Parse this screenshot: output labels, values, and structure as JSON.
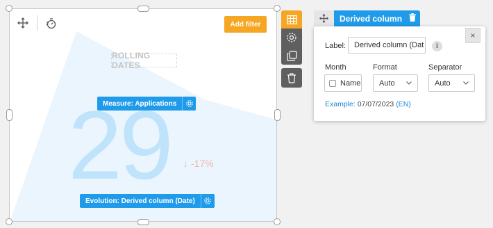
{
  "widget": {
    "add_filter_label": "Add filter",
    "placeholder_title": "ROLLING DATES",
    "kpi_value": "29",
    "evolution_arrow": "↓",
    "evolution_value": "-17%",
    "measure_pill": "Measure: Applications",
    "evolution_pill": "Evolution: Derived column (Date)",
    "toolbar": {
      "move_icon": "move-icon",
      "history_icon": "history-timer-icon"
    }
  },
  "side_tools": [
    {
      "icon": "table-icon",
      "active": true
    },
    {
      "icon": "gear-icon",
      "active": false
    },
    {
      "icon": "duplicate-icon",
      "active": false
    },
    {
      "icon": "trash-icon",
      "active": false
    }
  ],
  "panel": {
    "title": "Derived column",
    "label_caption": "Label:",
    "label_value": "Derived column (Dat",
    "info_glyph": "i",
    "close_glyph": "×",
    "month_caption": "Month",
    "format_caption": "Format",
    "separator_caption": "Separator",
    "month_checkbox_label": "Name",
    "format_value": "Auto",
    "separator_value": "Auto",
    "example_key": "Example:",
    "example_value": "07/07/2023",
    "example_locale": "(EN)"
  },
  "colors": {
    "accent_orange": "#f5a623",
    "accent_blue": "#1f9bea",
    "kpi_light_blue": "#bfe3fb",
    "negative_red": "#f2b5b0"
  }
}
